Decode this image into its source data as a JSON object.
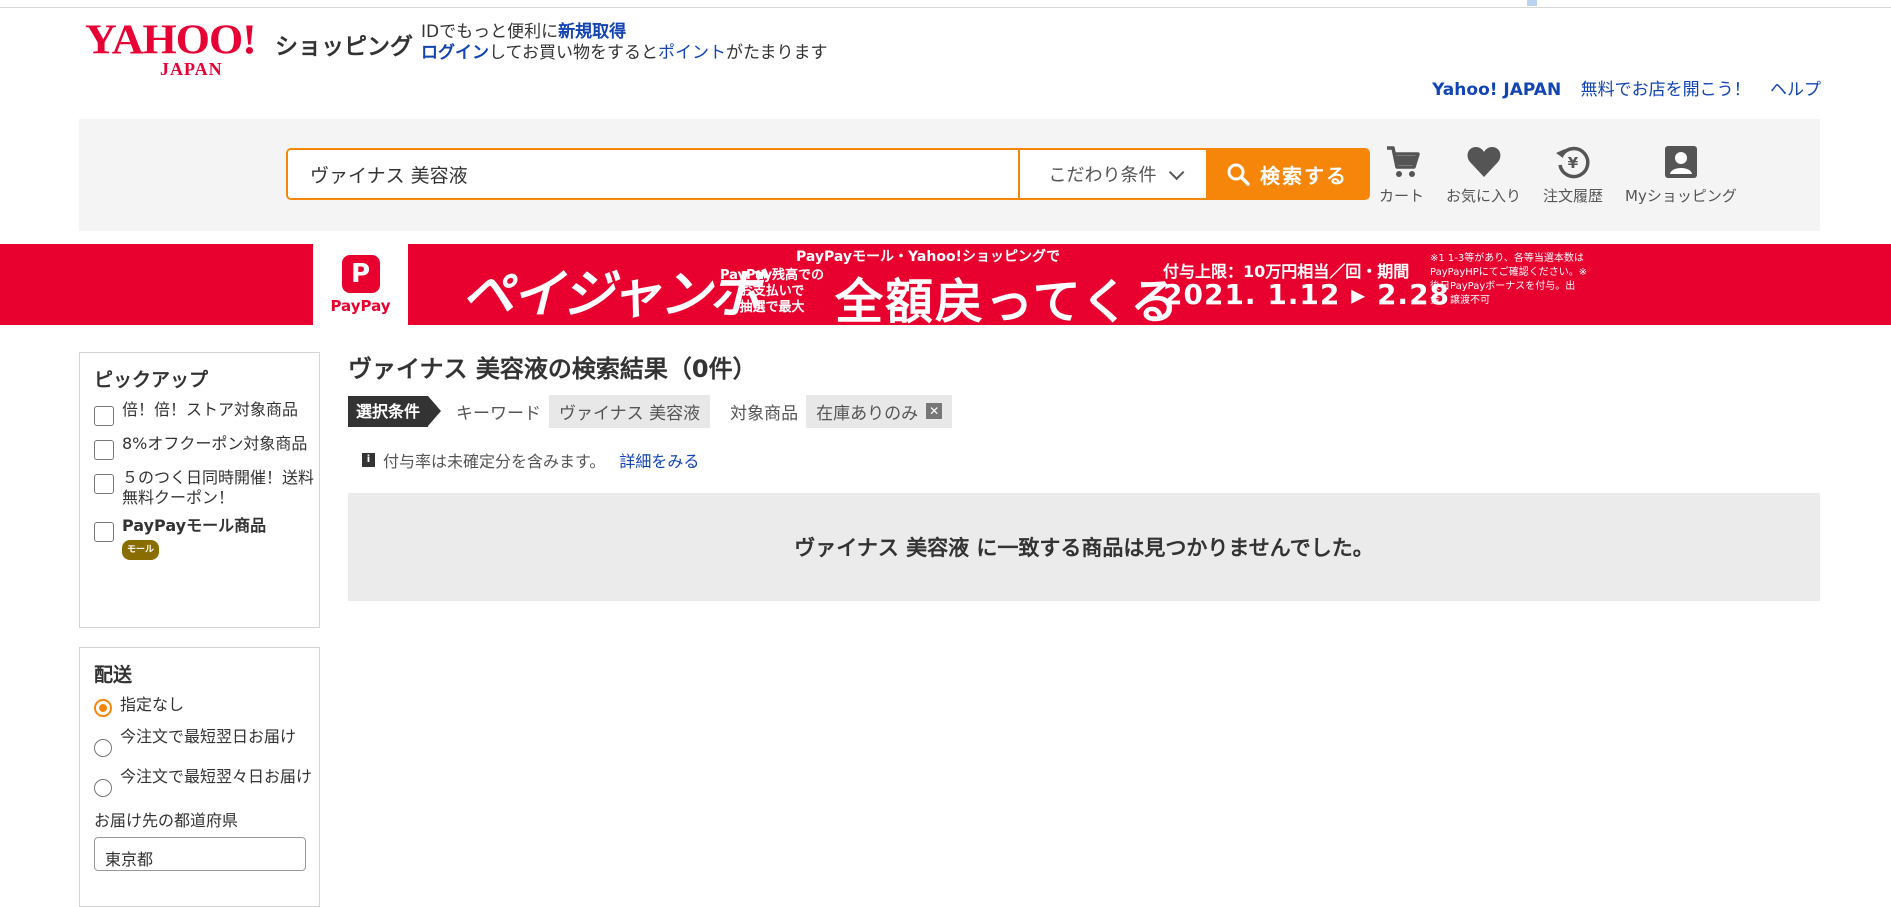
{
  "header": {
    "logo_text": "YAHOO!",
    "logo_sub": "JAPAN",
    "shop_word": "ショッピング",
    "login_line1_prefix": "IDでもっと便利に",
    "login_line1_link": "新規取得",
    "login_line2_link": "ログイン",
    "login_line2_middle": "してお買い物をすると",
    "login_line2_link2": "ポイント",
    "login_line2_suffix": "がたまります",
    "top_links": [
      "Yahoo! JAPAN",
      "無料でお店を開こう！",
      "ヘルプ"
    ]
  },
  "search": {
    "query": "ヴァイナス 美容液",
    "conditions_label": "こだわり条件",
    "button_label": "検索する"
  },
  "nav": {
    "items": [
      {
        "label": "カート",
        "icon": "cart-icon"
      },
      {
        "label": "お気に入り",
        "icon": "heart-icon"
      },
      {
        "label": "注文履歴",
        "icon": "history-icon"
      },
      {
        "label": "Myショッピング",
        "icon": "person-icon"
      }
    ]
  },
  "banner": {
    "paypay_mark": "P",
    "paypay_text": "PayPay",
    "jumbo_text": "ペイジャンボ",
    "top_text": "PayPayモール・Yahoo!ショッピングで",
    "sub_text": "PayPay残高での\nお支払いで\n抽選で最大",
    "main_text": "全額戻ってくる",
    "limit_text": "付与上限：10万円相当／回・期間",
    "period_text": "2021. 1.12 ▸ 2.28",
    "note_text": "※1 1-3等があり、各等当選本数はPayPayHPにてご確認ください。※後日PayPayボーナスを付与。出金・譲渡不可"
  },
  "sidebar": {
    "pickup_title": "ピックアップ",
    "pickup_items": [
      {
        "label": "倍！倍！ストア対象商品",
        "bold": false
      },
      {
        "label": "8%オフクーポン対象商品",
        "bold": false
      },
      {
        "label": "５のつく日同時開催！送料無料クーポン！",
        "bold": false
      },
      {
        "label": "PayPayモール商品",
        "bold": true,
        "badge": "モール"
      }
    ],
    "shipping_title": "配送",
    "shipping_options": [
      {
        "label": "指定なし",
        "selected": true
      },
      {
        "label": "今注文で最短翌日お届け",
        "selected": false
      },
      {
        "label": "今注文で最短翌々日お届け",
        "selected": false
      }
    ],
    "pref_label": "お届け先の都道府県",
    "pref_value": "東京都"
  },
  "main": {
    "result_title": "ヴァイナス 美容液の検索結果（0件）",
    "cond_tag": "選択条件",
    "keyword_label": "キーワード",
    "keyword_value": "ヴァイナス 美容液",
    "target_label": "対象商品",
    "target_value": "在庫ありのみ",
    "note_text": "付与率は未確定分を含みます。",
    "note_link": "詳細をみる",
    "empty_message": "ヴァイナス 美容液 に一致する商品は見つかりませんでした。"
  },
  "colors": {
    "accent": "#f6860a",
    "brand_red": "#e60033",
    "link": "#1244b3",
    "banner_red": "#e8002e"
  }
}
